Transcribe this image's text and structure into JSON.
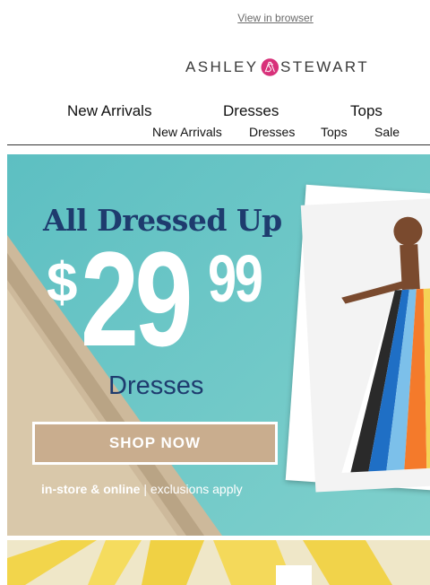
{
  "header": {
    "view_in_browser": "View in browser"
  },
  "brand": {
    "left": "ASHLEY",
    "right": "STEWART",
    "accent": "#d8317a"
  },
  "nav_primary": [
    "New Arrivals",
    "Dresses",
    "Tops"
  ],
  "nav_secondary": [
    "New Arrivals",
    "Dresses",
    "Tops",
    "Sale"
  ],
  "hero": {
    "headline": "All Dressed Up",
    "price_currency": "$",
    "price_whole": "29",
    "price_cents": "99",
    "subhead": "Dresses",
    "cta": "SHOP NOW",
    "footnote_bold": "in-store & online",
    "footnote_rest": " | exclusions apply",
    "colors": {
      "headline": "#1e3b6e",
      "pool": "#6fc7c6",
      "cta_bg": "#c9ad8e"
    }
  }
}
